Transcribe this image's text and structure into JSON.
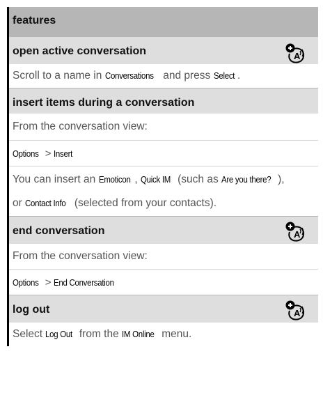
{
  "header": {
    "title": "features"
  },
  "sections": [
    {
      "title": "open active conversation",
      "icon": "network-dependent-feature-icon",
      "line1": {
        "pre": "Scroll to a name in ",
        "ui1": "Conversations",
        "mid": " and press ",
        "ui2": "Select",
        "post": "."
      }
    },
    {
      "title": "insert items during a conversation",
      "intro": "From the conversation view:",
      "path": {
        "a": "Options",
        "sep": ">",
        "b": "Insert"
      },
      "line3": {
        "pre": "You can insert an ",
        "ui1": "Emoticon",
        "c1": ", ",
        "ui2": "Quick IM",
        "mid": " (such as ",
        "ui3": "Are you there?",
        "post": "),",
        "continuation_pre": "or ",
        "ui4": "Contact Info",
        "continuation_post": " (selected from your contacts)."
      }
    },
    {
      "title": "end conversation",
      "icon": "network-dependent-feature-icon",
      "intro": "From the conversation view:",
      "path": {
        "a": "Options",
        "sep": ">",
        "b": "End Conversation"
      }
    },
    {
      "title": "log out",
      "icon": "network-dependent-feature-icon",
      "line1": {
        "pre": "Select ",
        "ui1": "Log Out",
        "mid": " from the ",
        "ui2": "IM Online",
        "post": " menu."
      }
    }
  ]
}
